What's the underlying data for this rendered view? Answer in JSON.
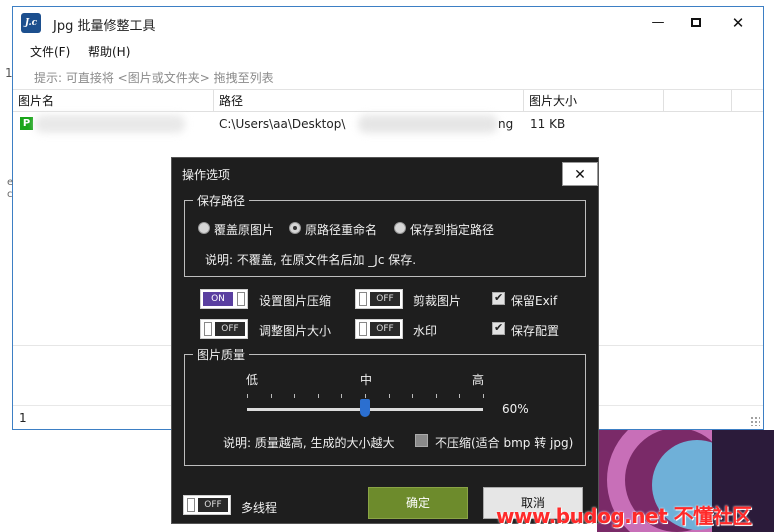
{
  "window": {
    "title": "Jpg 批量修整工具",
    "icon_text": "J.c",
    "icon": "app-logo-icon",
    "minimize_symbol": "—",
    "close_symbol": "✕"
  },
  "menu": {
    "file": "文件(F)",
    "help": "帮助(H)"
  },
  "hint": "提示: 可直接将 <图片或文件夹> 拖拽至列表",
  "left_digit": "1",
  "table": {
    "columns": [
      "图片名",
      "路径",
      "图片大小"
    ],
    "rows": [
      {
        "icon_text": "P",
        "path": "C:\\Users\\aa\\Desktop\\",
        "ext": "ng",
        "size": "11 KB"
      }
    ]
  },
  "edge_marks": "e\nc",
  "status": {
    "count": "1"
  },
  "dialog": {
    "title": "操作选项",
    "close_symbol": "✕",
    "save_path": {
      "group_title": "保存路径",
      "options": [
        "覆盖原图片",
        "原路径重命名",
        "保存到指定路径"
      ],
      "selected": "原路径重命名",
      "note": "说明: 不覆盖, 在原文件名后加 _Jc 保存."
    },
    "options": {
      "compress": {
        "label": "设置图片压缩",
        "state": "ON"
      },
      "crop": {
        "label": "剪裁图片",
        "state": "OFF"
      },
      "resize": {
        "label": "调整图片大小",
        "state": "OFF"
      },
      "watermark": {
        "label": "水印",
        "state": "OFF"
      },
      "keep_exif": {
        "label": "保留Exif",
        "checked": true
      },
      "save_config": {
        "label": "保存配置",
        "checked": true
      }
    },
    "quality": {
      "group_title": "图片质量",
      "low": "低",
      "mid": "中",
      "high": "高",
      "value": 60,
      "value_text": "60%",
      "note": "说明: 质量越高, 生成的大小越大",
      "no_compress": {
        "label": "不压缩(适合 bmp 转 jpg)",
        "checked": false
      }
    },
    "multithread": {
      "label": "多线程",
      "state": "OFF"
    },
    "ok_label": "确定",
    "cancel_label": "取消"
  },
  "watermark_text": "www.budog.net 不懂社区",
  "colors": {
    "dialog_bg": "#1e1e1e",
    "toggle_on": "#5a3fa0",
    "ok_button": "#6d8b2c",
    "slider_thumb": "#2b6fd0",
    "window_border": "#3d7fc4",
    "watermark": "#ff2a2a"
  }
}
